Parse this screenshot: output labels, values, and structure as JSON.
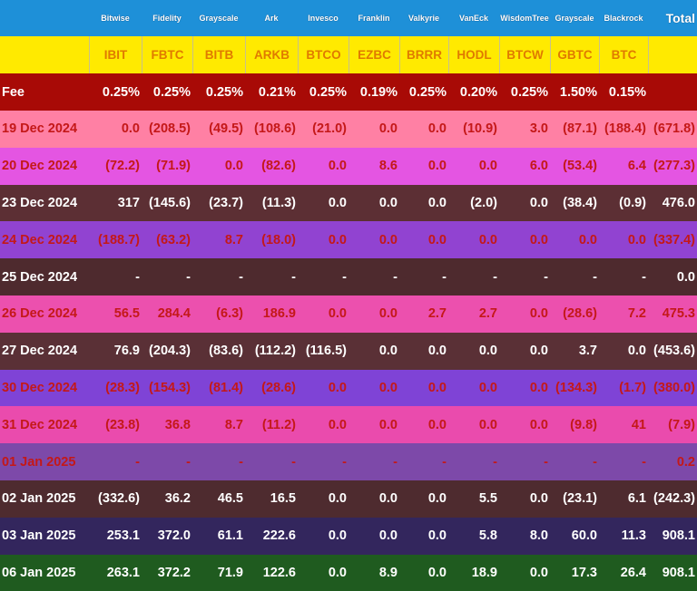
{
  "columns": [
    "",
    "Bitwise",
    "Fidelity",
    "Grayscale",
    "Ark",
    "Invesco",
    "Franklin",
    "Valkyrie",
    "VanEck",
    "WisdomTree",
    "Grayscale",
    "Blackrock",
    "Total"
  ],
  "column_labels_display": [
    "",
    "Bitwise",
    "Fidelity",
    "Grayscale",
    "Ark",
    "Invesco",
    "Franklin",
    "Valkyrie",
    "VanEck",
    "WisdomTree",
    "Grayscale",
    "Blackrock",
    "Total"
  ],
  "tickers": [
    "",
    "IBIT",
    "FBTC",
    "BITB",
    "ARKB",
    "BTCO",
    "EZBC",
    "BRRR",
    "HODL",
    "BTCW",
    "GBTC",
    "BTC",
    ""
  ],
  "fee": {
    "label": "Fee",
    "values": [
      "0.25%",
      "0.25%",
      "0.25%",
      "0.21%",
      "0.25%",
      "0.19%",
      "0.25%",
      "0.20%",
      "0.25%",
      "1.50%",
      "0.15%",
      ""
    ]
  },
  "rows": [
    {
      "date": "19 Dec 2024",
      "values": [
        "0.0",
        "(208.5)",
        "(49.5)",
        "(108.6)",
        "(21.0)",
        "0.0",
        "0.0",
        "(10.9)",
        "3.0",
        "(87.1)",
        "(188.4)",
        "(671.8)"
      ]
    },
    {
      "date": "20 Dec 2024",
      "values": [
        "(72.2)",
        "(71.9)",
        "0.0",
        "(82.6)",
        "0.0",
        "8.6",
        "0.0",
        "0.0",
        "6.0",
        "(53.4)",
        "6.4",
        "(277.3)"
      ]
    },
    {
      "date": "23 Dec 2024",
      "values": [
        "317",
        "(145.6)",
        "(23.7)",
        "(11.3)",
        "0.0",
        "0.0",
        "0.0",
        "(2.0)",
        "0.0",
        "(38.4)",
        "(0.9)",
        "476.0"
      ]
    },
    {
      "date": "24 Dec 2024",
      "values": [
        "(188.7)",
        "(63.2)",
        "8.7",
        "(18.0)",
        "0.0",
        "0.0",
        "0.0",
        "0.0",
        "0.0",
        "0.0",
        "0.0",
        "(337.4)"
      ]
    },
    {
      "date": "25 Dec 2024",
      "values": [
        "-",
        "-",
        "-",
        "-",
        "-",
        "-",
        "-",
        "-",
        "-",
        "-",
        "-",
        "0.0"
      ]
    },
    {
      "date": "26 Dec 2024",
      "values": [
        "56.5",
        "284.4",
        "(6.3)",
        "186.9",
        "0.0",
        "0.0",
        "2.7",
        "2.7",
        "0.0",
        "(28.6)",
        "7.2",
        "475.3"
      ]
    },
    {
      "date": "27 Dec 2024",
      "values": [
        "76.9",
        "(204.3)",
        "(83.6)",
        "(112.2)",
        "(116.5)",
        "0.0",
        "0.0",
        "0.0",
        "0.0",
        "3.7",
        "0.0",
        "(453.6)"
      ]
    },
    {
      "date": "30 Dec 2024",
      "values": [
        "(28.3)",
        "(154.3)",
        "(81.4)",
        "(28.6)",
        "0.0",
        "0.0",
        "0.0",
        "0.0",
        "0.0",
        "(134.3)",
        "(1.7)",
        "(380.0)"
      ]
    },
    {
      "date": "31 Dec 2024",
      "values": [
        "(23.8)",
        "36.8",
        "8.7",
        "(11.2)",
        "0.0",
        "0.0",
        "0.0",
        "0.0",
        "0.0",
        "(9.8)",
        "41",
        "(7.9)"
      ]
    },
    {
      "date": "01 Jan 2025",
      "values": [
        "-",
        "-",
        "-",
        "-",
        "-",
        "-",
        "-",
        "-",
        "-",
        "-",
        "-",
        "0.2"
      ]
    },
    {
      "date": "02 Jan 2025",
      "values": [
        "(332.6)",
        "36.2",
        "46.5",
        "16.5",
        "0.0",
        "0.0",
        "0.0",
        "5.5",
        "0.0",
        "(23.1)",
        "6.1",
        "(242.3)"
      ]
    },
    {
      "date": "03 Jan 2025",
      "values": [
        "253.1",
        "372.0",
        "61.1",
        "222.6",
        "0.0",
        "0.0",
        "0.0",
        "5.8",
        "8.0",
        "60.0",
        "11.3",
        "908.1"
      ]
    },
    {
      "date": "06 Jan 2025",
      "values": [
        "263.1",
        "372.2",
        "71.9",
        "122.6",
        "0.0",
        "8.9",
        "0.0",
        "18.9",
        "0.0",
        "17.3",
        "26.4",
        "908.1"
      ]
    }
  ],
  "colors": {
    "header_bg": "#1e90d8",
    "ticker_bg": "#ffea00",
    "ticker_text": "#e07a00",
    "fee_bg": "#a80a06",
    "row_text_red": "#c41818",
    "row_text_white": "#ffffff"
  },
  "row_styles": [
    {
      "bg": "#ff80a4",
      "fg": "#c41818"
    },
    {
      "bg": "#e455e2",
      "fg": "#c41818"
    },
    {
      "bg": "#5c2f34",
      "fg": "#ffffff"
    },
    {
      "bg": "#9143d1",
      "fg": "#c41818"
    },
    {
      "bg": "#4e2a2e",
      "fg": "#ffffff"
    },
    {
      "bg": "#ec50ae",
      "fg": "#c41818"
    },
    {
      "bg": "#5a3036",
      "fg": "#ffffff"
    },
    {
      "bg": "#7f43d6",
      "fg": "#c41818"
    },
    {
      "bg": "#ea4bad",
      "fg": "#c41818"
    },
    {
      "bg": "#7d49a9",
      "fg": "#c41818"
    },
    {
      "bg": "#4e2b2f",
      "fg": "#ffffff"
    },
    {
      "bg": "#33265d",
      "fg": "#ffffff"
    },
    {
      "bg": "#1f5b1f",
      "fg": "#ffffff"
    }
  ]
}
